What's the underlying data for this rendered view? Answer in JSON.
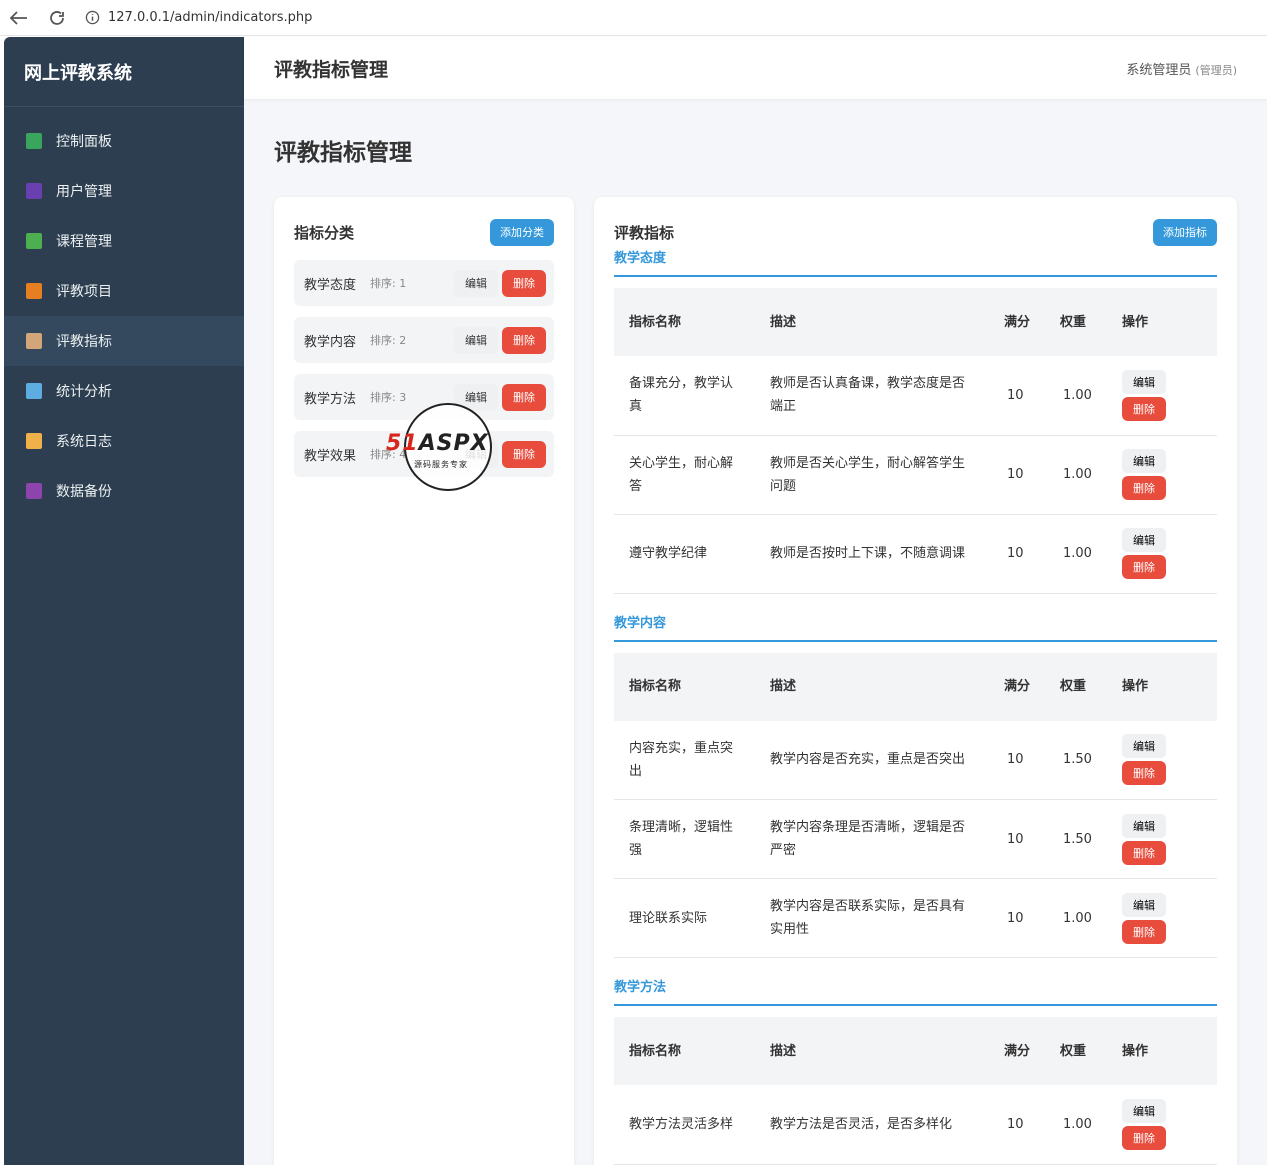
{
  "browser": {
    "url": "127.0.0.1/admin/indicators.php"
  },
  "sidebar": {
    "brand": "网上评教系统",
    "items": [
      {
        "label": "控制面板",
        "icon": "bar-chart-icon",
        "color": "#3aa55d"
      },
      {
        "label": "用户管理",
        "icon": "users-icon",
        "color": "#6a3fb0"
      },
      {
        "label": "课程管理",
        "icon": "books-icon",
        "color": "#4caf50"
      },
      {
        "label": "评教项目",
        "icon": "memo-icon",
        "color": "#e67e22"
      },
      {
        "label": "评教指标",
        "icon": "clipboard-icon",
        "color": "#d2a679"
      },
      {
        "label": "统计分析",
        "icon": "trend-chart-icon",
        "color": "#5dade2"
      },
      {
        "label": "系统日志",
        "icon": "scroll-icon",
        "color": "#f0b14a"
      },
      {
        "label": "数据备份",
        "icon": "floppy-disk-icon",
        "color": "#8e44ad"
      }
    ]
  },
  "header": {
    "title": "评教指标管理",
    "user": "系统管理员",
    "role": "(管理员)"
  },
  "page": {
    "title": "评教指标管理"
  },
  "categories": {
    "title": "指标分类",
    "add_label": "添加分类",
    "edit_label": "编辑",
    "delete_label": "删除",
    "items": [
      {
        "name": "教学态度",
        "order": "排序: 1"
      },
      {
        "name": "教学内容",
        "order": "排序: 2"
      },
      {
        "name": "教学方法",
        "order": "排序: 3"
      },
      {
        "name": "教学效果",
        "order": "排序: 4"
      }
    ]
  },
  "indicators": {
    "title": "评教指标",
    "add_label": "添加指标",
    "columns": [
      "指标名称",
      "描述",
      "满分",
      "权重",
      "操作"
    ],
    "edit_label": "编辑",
    "delete_label": "删除",
    "sections": [
      {
        "name": "教学态度",
        "rows": [
          {
            "name": "备课充分，教学认真",
            "desc": "教师是否认真备课，教学态度是否端正",
            "score": "10",
            "weight": "1.00"
          },
          {
            "name": "关心学生，耐心解答",
            "desc": "教师是否关心学生，耐心解答学生问题",
            "score": "10",
            "weight": "1.00"
          },
          {
            "name": "遵守教学纪律",
            "desc": "教师是否按时上下课，不随意调课",
            "score": "10",
            "weight": "1.00"
          }
        ]
      },
      {
        "name": "教学内容",
        "rows": [
          {
            "name": "内容充实，重点突出",
            "desc": "教学内容是否充实，重点是否突出",
            "score": "10",
            "weight": "1.50"
          },
          {
            "name": "条理清晰，逻辑性强",
            "desc": "教学内容条理是否清晰，逻辑是否严密",
            "score": "10",
            "weight": "1.50"
          },
          {
            "name": "理论联系实际",
            "desc": "教学内容是否联系实际，是否具有实用性",
            "score": "10",
            "weight": "1.00"
          }
        ]
      },
      {
        "name": "教学方法",
        "rows": [
          {
            "name": "教学方法灵活多样",
            "desc": "教学方法是否灵活，是否多样化",
            "score": "10",
            "weight": "1.00"
          }
        ]
      }
    ]
  },
  "watermark": {
    "brand_red": "51",
    "brand_rest": "ASPX",
    "sub": "源码服务专家"
  }
}
